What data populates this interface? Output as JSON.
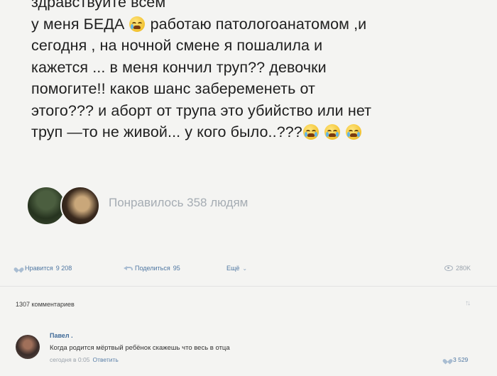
{
  "post": {
    "lines": [
      "здравствуйте всем",
      "у меня БЕДА",
      "работаю патологоанатомом ,и",
      "сегодня , на ночной смене я пошалила и",
      "кажется ... в меня кончил труп?? девочки",
      "помогите!! каков шанс забеременеть от",
      "этого??? и аборт от трупа это убийство или нет",
      "труп —то не живой...  у кого было..???"
    ],
    "emoji_sad": "crying-face-icon",
    "emoji_sob": "loudly-crying-face-icon"
  },
  "likers": {
    "text": "Понравилось 358 людям"
  },
  "actions": {
    "like_label": "Нравится",
    "like_count": "9 208",
    "share_label": "Поделиться",
    "share_count": "95",
    "more_label": "Ещё",
    "views": "280K"
  },
  "comments": {
    "count_label": "1307 комментариев",
    "sort_icon": "sort-icon",
    "items": [
      {
        "author": "Павел .",
        "text": "Когда родится мёртвый ребёнок скажешь что весь в отца",
        "time": "сегодня в 0:05",
        "reply_label": "Ответить",
        "likes": "3 529"
      }
    ]
  },
  "colors": {
    "background": "#f4f4f2",
    "link": "#4f77a2",
    "muted": "#a5acb3"
  }
}
